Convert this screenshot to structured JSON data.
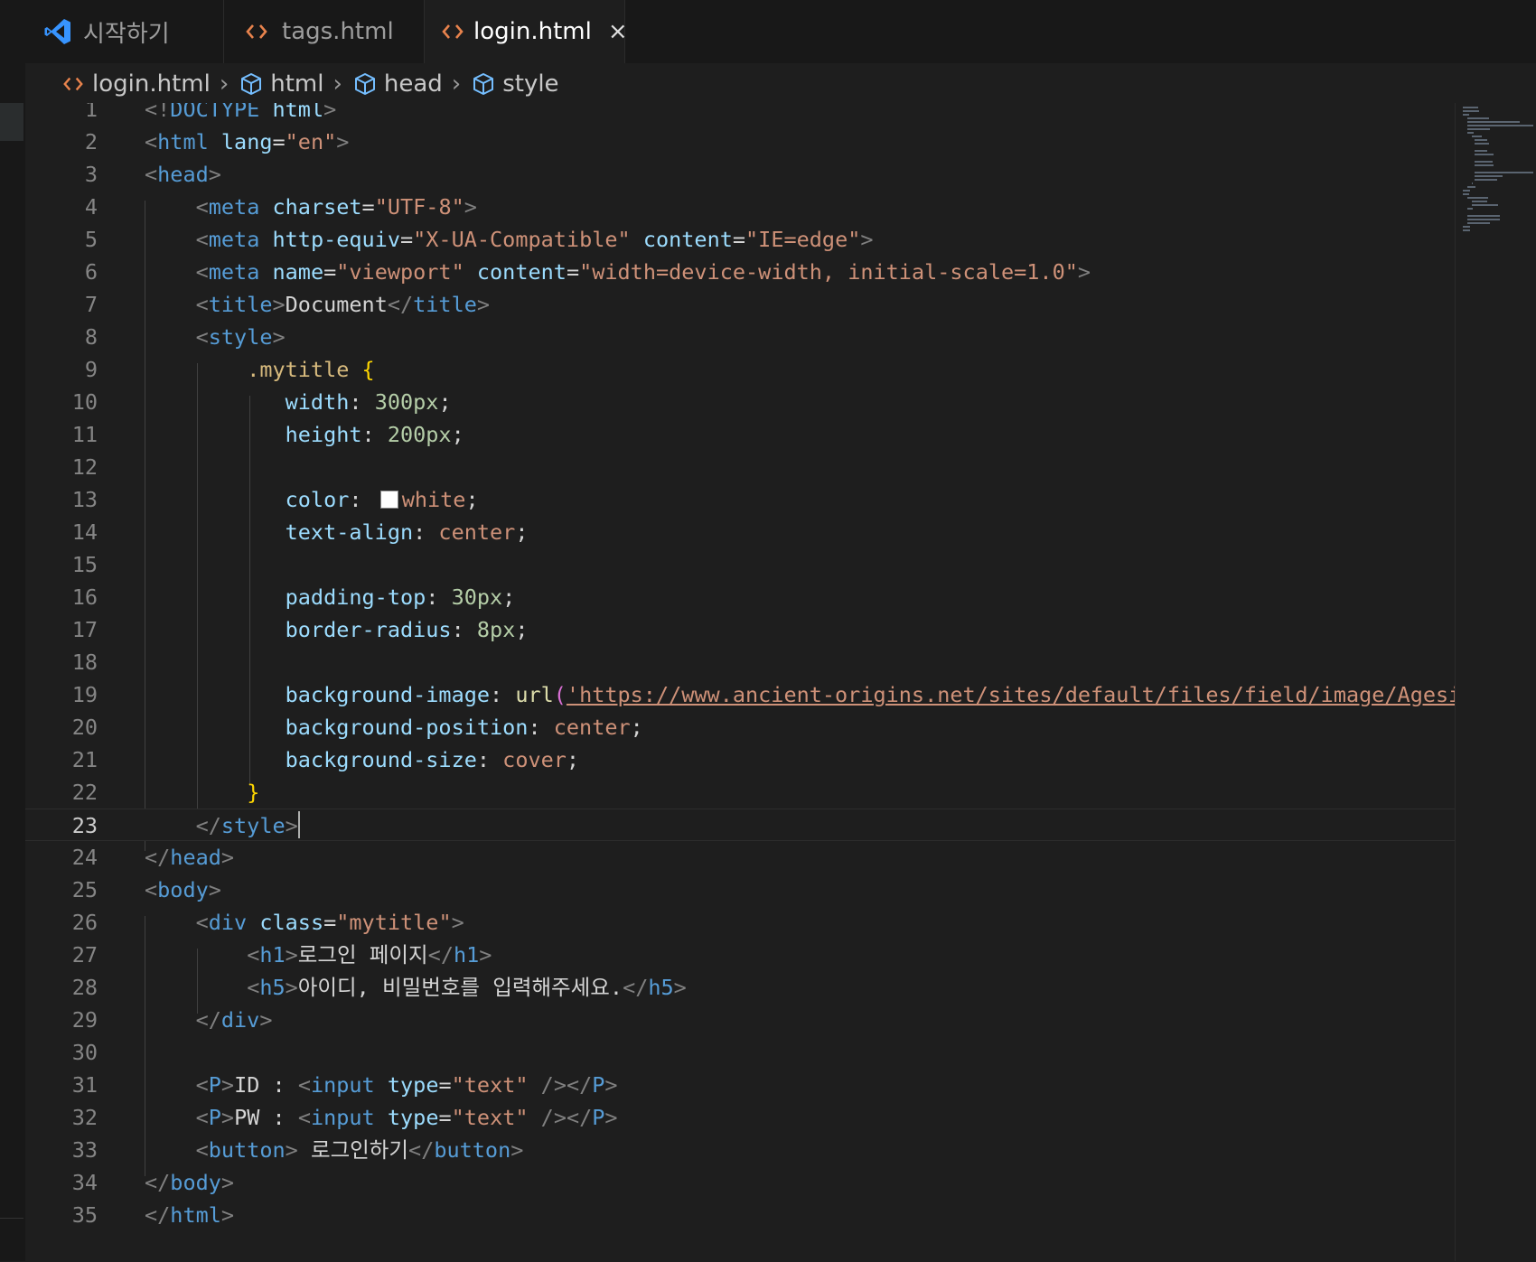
{
  "tabs": [
    {
      "label": "시작하기",
      "icon": "vscode-logo-icon",
      "active": false
    },
    {
      "label": "tags.html",
      "icon": "html-file-icon",
      "active": false
    },
    {
      "label": "login.html",
      "icon": "html-file-icon",
      "active": true,
      "close": "×"
    }
  ],
  "breadcrumb": [
    {
      "label": "login.html",
      "icon": "html-file-icon"
    },
    {
      "label": "html",
      "icon": "element-box-icon"
    },
    {
      "label": "head",
      "icon": "element-box-icon"
    },
    {
      "label": "style",
      "icon": "element-box-icon"
    }
  ],
  "editor": {
    "current_line": 23,
    "line_numbers": [
      "1",
      "2",
      "3",
      "4",
      "5",
      "6",
      "7",
      "8",
      "9",
      "10",
      "11",
      "12",
      "13",
      "14",
      "15",
      "16",
      "17",
      "18",
      "19",
      "20",
      "21",
      "22",
      "23",
      "24",
      "25",
      "26",
      "27",
      "28",
      "29",
      "30",
      "31",
      "32",
      "33",
      "34",
      "35"
    ],
    "lines": [
      [
        [
          "punct",
          "<!"
        ],
        [
          "tag",
          "DOCTYPE"
        ],
        [
          "text",
          " "
        ],
        [
          "attr",
          "html"
        ],
        [
          "punct",
          ">"
        ]
      ],
      [
        [
          "punct",
          "<"
        ],
        [
          "tag",
          "html"
        ],
        [
          "text",
          " "
        ],
        [
          "attr",
          "lang"
        ],
        [
          "text",
          "="
        ],
        [
          "str",
          "\"en\""
        ],
        [
          "punct",
          ">"
        ]
      ],
      [
        [
          "punct",
          "<"
        ],
        [
          "tag",
          "head"
        ],
        [
          "punct",
          ">"
        ]
      ],
      [
        [
          "text",
          "    "
        ],
        [
          "punct",
          "<"
        ],
        [
          "tag",
          "meta"
        ],
        [
          "text",
          " "
        ],
        [
          "attr",
          "charset"
        ],
        [
          "text",
          "="
        ],
        [
          "str",
          "\"UTF-8\""
        ],
        [
          "punct",
          ">"
        ]
      ],
      [
        [
          "text",
          "    "
        ],
        [
          "punct",
          "<"
        ],
        [
          "tag",
          "meta"
        ],
        [
          "text",
          " "
        ],
        [
          "attr",
          "http-equiv"
        ],
        [
          "text",
          "="
        ],
        [
          "str",
          "\"X-UA-Compatible\""
        ],
        [
          "text",
          " "
        ],
        [
          "attr",
          "content"
        ],
        [
          "text",
          "="
        ],
        [
          "str",
          "\"IE=edge\""
        ],
        [
          "punct",
          ">"
        ]
      ],
      [
        [
          "text",
          "    "
        ],
        [
          "punct",
          "<"
        ],
        [
          "tag",
          "meta"
        ],
        [
          "text",
          " "
        ],
        [
          "attr",
          "name"
        ],
        [
          "text",
          "="
        ],
        [
          "str",
          "\"viewport\""
        ],
        [
          "text",
          " "
        ],
        [
          "attr",
          "content"
        ],
        [
          "text",
          "="
        ],
        [
          "str",
          "\"width=device-width, initial-scale=1.0\""
        ],
        [
          "punct",
          ">"
        ]
      ],
      [
        [
          "text",
          "    "
        ],
        [
          "punct",
          "<"
        ],
        [
          "tag",
          "title"
        ],
        [
          "punct",
          ">"
        ],
        [
          "text",
          "Document"
        ],
        [
          "punct",
          "</"
        ],
        [
          "tag",
          "title"
        ],
        [
          "punct",
          ">"
        ]
      ],
      [
        [
          "text",
          "    "
        ],
        [
          "punct",
          "<"
        ],
        [
          "tag",
          "style"
        ],
        [
          "punct",
          ">"
        ]
      ],
      [
        [
          "text",
          "        "
        ],
        [
          "sel",
          ".mytitle"
        ],
        [
          "text",
          " "
        ],
        [
          "brace",
          "{"
        ]
      ],
      [
        [
          "text",
          "           "
        ],
        [
          "prop",
          "width"
        ],
        [
          "text",
          ": "
        ],
        [
          "num",
          "300px"
        ],
        [
          "text",
          ";"
        ]
      ],
      [
        [
          "text",
          "           "
        ],
        [
          "prop",
          "height"
        ],
        [
          "text",
          ": "
        ],
        [
          "num",
          "200px"
        ],
        [
          "text",
          ";"
        ]
      ],
      [],
      [
        [
          "text",
          "           "
        ],
        [
          "prop",
          "color"
        ],
        [
          "text",
          ": "
        ],
        [
          "swatch",
          "white"
        ],
        [
          "val",
          "white"
        ],
        [
          "text",
          ";"
        ]
      ],
      [
        [
          "text",
          "           "
        ],
        [
          "prop",
          "text-align"
        ],
        [
          "text",
          ": "
        ],
        [
          "val",
          "center"
        ],
        [
          "text",
          ";"
        ]
      ],
      [],
      [
        [
          "text",
          "           "
        ],
        [
          "prop",
          "padding-top"
        ],
        [
          "text",
          ": "
        ],
        [
          "num",
          "30px"
        ],
        [
          "text",
          ";"
        ]
      ],
      [
        [
          "text",
          "           "
        ],
        [
          "prop",
          "border-radius"
        ],
        [
          "text",
          ": "
        ],
        [
          "num",
          "8px"
        ],
        [
          "text",
          ";"
        ]
      ],
      [],
      [
        [
          "text",
          "           "
        ],
        [
          "prop",
          "background-image"
        ],
        [
          "text",
          ": "
        ],
        [
          "fn",
          "url"
        ],
        [
          "paren",
          "("
        ],
        [
          "url",
          "'https://www.ancient-origins.net/sites/default/files/field/image/Agesilaus-II-cover.jpg'"
        ],
        [
          "paren",
          ")"
        ],
        [
          "text",
          ";"
        ]
      ],
      [
        [
          "text",
          "           "
        ],
        [
          "prop",
          "background-position"
        ],
        [
          "text",
          ": "
        ],
        [
          "val",
          "center"
        ],
        [
          "text",
          ";"
        ]
      ],
      [
        [
          "text",
          "           "
        ],
        [
          "prop",
          "background-size"
        ],
        [
          "text",
          ": "
        ],
        [
          "val",
          "cover"
        ],
        [
          "text",
          ";"
        ]
      ],
      [
        [
          "text",
          "        "
        ],
        [
          "brace",
          "}"
        ]
      ],
      [
        [
          "text",
          "    "
        ],
        [
          "punct",
          "</"
        ],
        [
          "tag",
          "style"
        ],
        [
          "punct",
          ">"
        ],
        [
          "cursor",
          ""
        ]
      ],
      [
        [
          "punct",
          "</"
        ],
        [
          "tag",
          "head"
        ],
        [
          "punct",
          ">"
        ]
      ],
      [
        [
          "punct",
          "<"
        ],
        [
          "tag",
          "body"
        ],
        [
          "punct",
          ">"
        ]
      ],
      [
        [
          "text",
          "    "
        ],
        [
          "punct",
          "<"
        ],
        [
          "tag",
          "div"
        ],
        [
          "text",
          " "
        ],
        [
          "attr",
          "class"
        ],
        [
          "text",
          "="
        ],
        [
          "str",
          "\"mytitle\""
        ],
        [
          "punct",
          ">"
        ]
      ],
      [
        [
          "text",
          "        "
        ],
        [
          "punct",
          "<"
        ],
        [
          "tag",
          "h1"
        ],
        [
          "punct",
          ">"
        ],
        [
          "text",
          "로그인 페이지"
        ],
        [
          "punct",
          "</"
        ],
        [
          "tag",
          "h1"
        ],
        [
          "punct",
          ">"
        ]
      ],
      [
        [
          "text",
          "        "
        ],
        [
          "punct",
          "<"
        ],
        [
          "tag",
          "h5"
        ],
        [
          "punct",
          ">"
        ],
        [
          "text",
          "아이디, 비밀번호를 입력해주세요."
        ],
        [
          "punct",
          "</"
        ],
        [
          "tag",
          "h5"
        ],
        [
          "punct",
          ">"
        ]
      ],
      [
        [
          "text",
          "    "
        ],
        [
          "punct",
          "</"
        ],
        [
          "tag",
          "div"
        ],
        [
          "punct",
          ">"
        ]
      ],
      [],
      [
        [
          "text",
          "    "
        ],
        [
          "punct",
          "<"
        ],
        [
          "tag",
          "P"
        ],
        [
          "punct",
          ">"
        ],
        [
          "text",
          "ID : "
        ],
        [
          "punct",
          "<"
        ],
        [
          "tag",
          "input"
        ],
        [
          "text",
          " "
        ],
        [
          "attr",
          "type"
        ],
        [
          "text",
          "="
        ],
        [
          "str",
          "\"text\""
        ],
        [
          "text",
          " "
        ],
        [
          "punct",
          "/></"
        ],
        [
          "tag",
          "P"
        ],
        [
          "punct",
          ">"
        ]
      ],
      [
        [
          "text",
          "    "
        ],
        [
          "punct",
          "<"
        ],
        [
          "tag",
          "P"
        ],
        [
          "punct",
          ">"
        ],
        [
          "text",
          "PW : "
        ],
        [
          "punct",
          "<"
        ],
        [
          "tag",
          "input"
        ],
        [
          "text",
          " "
        ],
        [
          "attr",
          "type"
        ],
        [
          "text",
          "="
        ],
        [
          "str",
          "\"text\""
        ],
        [
          "text",
          " "
        ],
        [
          "punct",
          "/></"
        ],
        [
          "tag",
          "P"
        ],
        [
          "punct",
          ">"
        ]
      ],
      [
        [
          "text",
          "    "
        ],
        [
          "punct",
          "<"
        ],
        [
          "tag",
          "button"
        ],
        [
          "punct",
          ">"
        ],
        [
          "text",
          " 로그인하기"
        ],
        [
          "punct",
          "</"
        ],
        [
          "tag",
          "button"
        ],
        [
          "punct",
          ">"
        ]
      ],
      [
        [
          "punct",
          "</"
        ],
        [
          "tag",
          "body"
        ],
        [
          "punct",
          ">"
        ]
      ],
      [
        [
          "punct",
          "</"
        ],
        [
          "tag",
          "html"
        ],
        [
          "punct",
          ">"
        ]
      ]
    ]
  },
  "colors": {
    "background": "#1e1e1e",
    "tag": "#569cd6",
    "attribute": "#9cdcfe",
    "string": "#ce9178",
    "number": "#b5cea8",
    "selector": "#d7ba7d",
    "brace": "#ffd700",
    "file_icon": "#e8834d",
    "vscode_logo": "#3794ff"
  }
}
